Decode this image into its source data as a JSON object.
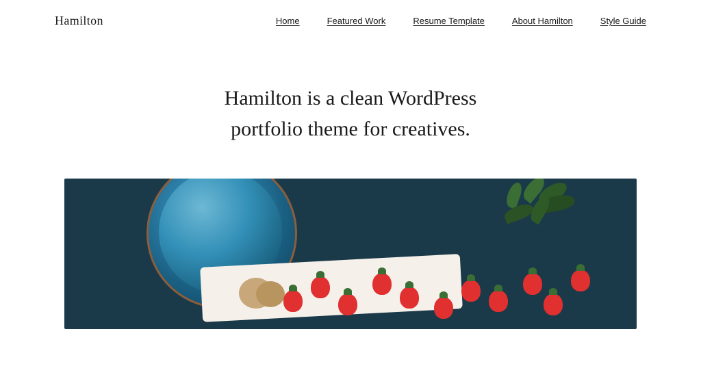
{
  "site": {
    "title": "Hamilton"
  },
  "nav": {
    "items": [
      {
        "label": "Home",
        "href": "#"
      },
      {
        "label": "Featured Work",
        "href": "#"
      },
      {
        "label": "Resume Template",
        "href": "#"
      },
      {
        "label": "About Hamilton",
        "href": "#"
      },
      {
        "label": "Style Guide",
        "href": "#"
      }
    ]
  },
  "hero": {
    "text": "Hamilton is a clean WordPress portfolio theme for creatives."
  }
}
